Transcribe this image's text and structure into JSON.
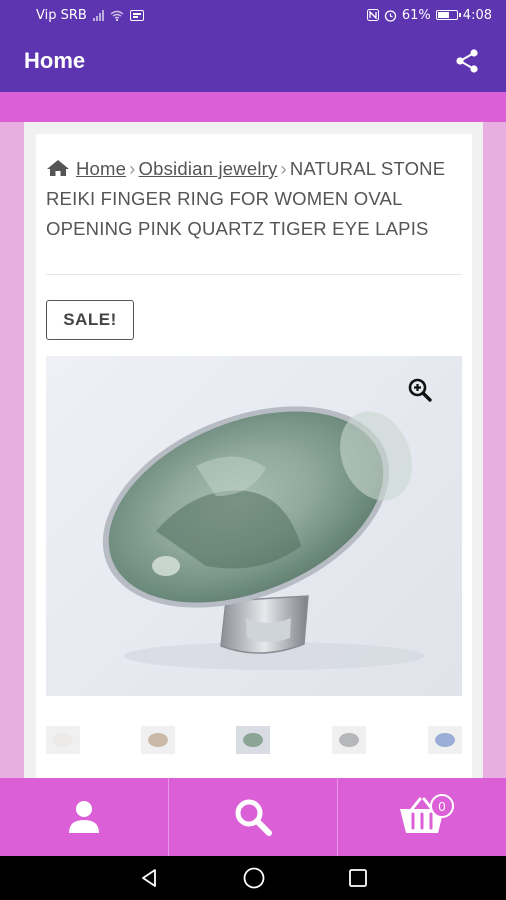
{
  "status_bar": {
    "carrier": "Vip SRB",
    "battery": "61%",
    "time": "4:08"
  },
  "app_bar": {
    "title": "Home",
    "share_icon": "share-icon"
  },
  "breadcrumb": {
    "home": "Home",
    "category": "Obsidian jewelry",
    "product": "NATURAL STONE REIKI FINGER RING FOR WOMEN OVAL OPENING PINK QUARTZ TIGER EYE LAPIS"
  },
  "product": {
    "sale_badge": "SALE!",
    "zoom_icon": "zoom-in-icon"
  },
  "thumbnails": [
    {
      "color": "#eceae8"
    },
    {
      "color": "#c9b9a6"
    },
    {
      "color": "#8aa596"
    },
    {
      "color": "#b6b7bb"
    },
    {
      "color": "#9aaed8"
    }
  ],
  "bottom_nav": {
    "cart_count": "0",
    "icons": [
      "account-icon",
      "search-icon",
      "cart-icon"
    ]
  },
  "colors": {
    "primary": "#5e35b1",
    "accent": "#db5fd6",
    "page_bg": "#e8aee0"
  }
}
